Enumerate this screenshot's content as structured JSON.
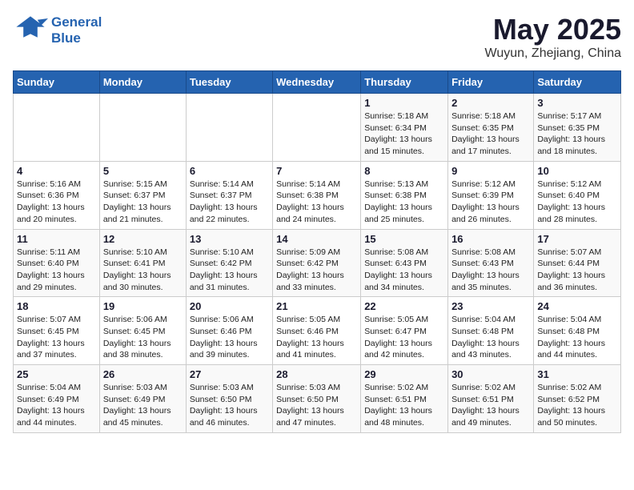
{
  "logo": {
    "line1": "General",
    "line2": "Blue"
  },
  "title": "May 2025",
  "location": "Wuyun, Zhejiang, China",
  "days_of_week": [
    "Sunday",
    "Monday",
    "Tuesday",
    "Wednesday",
    "Thursday",
    "Friday",
    "Saturday"
  ],
  "weeks": [
    [
      {
        "day": "",
        "info": ""
      },
      {
        "day": "",
        "info": ""
      },
      {
        "day": "",
        "info": ""
      },
      {
        "day": "",
        "info": ""
      },
      {
        "day": "1",
        "info": "Sunrise: 5:18 AM\nSunset: 6:34 PM\nDaylight: 13 hours\nand 15 minutes."
      },
      {
        "day": "2",
        "info": "Sunrise: 5:18 AM\nSunset: 6:35 PM\nDaylight: 13 hours\nand 17 minutes."
      },
      {
        "day": "3",
        "info": "Sunrise: 5:17 AM\nSunset: 6:35 PM\nDaylight: 13 hours\nand 18 minutes."
      }
    ],
    [
      {
        "day": "4",
        "info": "Sunrise: 5:16 AM\nSunset: 6:36 PM\nDaylight: 13 hours\nand 20 minutes."
      },
      {
        "day": "5",
        "info": "Sunrise: 5:15 AM\nSunset: 6:37 PM\nDaylight: 13 hours\nand 21 minutes."
      },
      {
        "day": "6",
        "info": "Sunrise: 5:14 AM\nSunset: 6:37 PM\nDaylight: 13 hours\nand 22 minutes."
      },
      {
        "day": "7",
        "info": "Sunrise: 5:14 AM\nSunset: 6:38 PM\nDaylight: 13 hours\nand 24 minutes."
      },
      {
        "day": "8",
        "info": "Sunrise: 5:13 AM\nSunset: 6:38 PM\nDaylight: 13 hours\nand 25 minutes."
      },
      {
        "day": "9",
        "info": "Sunrise: 5:12 AM\nSunset: 6:39 PM\nDaylight: 13 hours\nand 26 minutes."
      },
      {
        "day": "10",
        "info": "Sunrise: 5:12 AM\nSunset: 6:40 PM\nDaylight: 13 hours\nand 28 minutes."
      }
    ],
    [
      {
        "day": "11",
        "info": "Sunrise: 5:11 AM\nSunset: 6:40 PM\nDaylight: 13 hours\nand 29 minutes."
      },
      {
        "day": "12",
        "info": "Sunrise: 5:10 AM\nSunset: 6:41 PM\nDaylight: 13 hours\nand 30 minutes."
      },
      {
        "day": "13",
        "info": "Sunrise: 5:10 AM\nSunset: 6:42 PM\nDaylight: 13 hours\nand 31 minutes."
      },
      {
        "day": "14",
        "info": "Sunrise: 5:09 AM\nSunset: 6:42 PM\nDaylight: 13 hours\nand 33 minutes."
      },
      {
        "day": "15",
        "info": "Sunrise: 5:08 AM\nSunset: 6:43 PM\nDaylight: 13 hours\nand 34 minutes."
      },
      {
        "day": "16",
        "info": "Sunrise: 5:08 AM\nSunset: 6:43 PM\nDaylight: 13 hours\nand 35 minutes."
      },
      {
        "day": "17",
        "info": "Sunrise: 5:07 AM\nSunset: 6:44 PM\nDaylight: 13 hours\nand 36 minutes."
      }
    ],
    [
      {
        "day": "18",
        "info": "Sunrise: 5:07 AM\nSunset: 6:45 PM\nDaylight: 13 hours\nand 37 minutes."
      },
      {
        "day": "19",
        "info": "Sunrise: 5:06 AM\nSunset: 6:45 PM\nDaylight: 13 hours\nand 38 minutes."
      },
      {
        "day": "20",
        "info": "Sunrise: 5:06 AM\nSunset: 6:46 PM\nDaylight: 13 hours\nand 39 minutes."
      },
      {
        "day": "21",
        "info": "Sunrise: 5:05 AM\nSunset: 6:46 PM\nDaylight: 13 hours\nand 41 minutes."
      },
      {
        "day": "22",
        "info": "Sunrise: 5:05 AM\nSunset: 6:47 PM\nDaylight: 13 hours\nand 42 minutes."
      },
      {
        "day": "23",
        "info": "Sunrise: 5:04 AM\nSunset: 6:48 PM\nDaylight: 13 hours\nand 43 minutes."
      },
      {
        "day": "24",
        "info": "Sunrise: 5:04 AM\nSunset: 6:48 PM\nDaylight: 13 hours\nand 44 minutes."
      }
    ],
    [
      {
        "day": "25",
        "info": "Sunrise: 5:04 AM\nSunset: 6:49 PM\nDaylight: 13 hours\nand 44 minutes."
      },
      {
        "day": "26",
        "info": "Sunrise: 5:03 AM\nSunset: 6:49 PM\nDaylight: 13 hours\nand 45 minutes."
      },
      {
        "day": "27",
        "info": "Sunrise: 5:03 AM\nSunset: 6:50 PM\nDaylight: 13 hours\nand 46 minutes."
      },
      {
        "day": "28",
        "info": "Sunrise: 5:03 AM\nSunset: 6:50 PM\nDaylight: 13 hours\nand 47 minutes."
      },
      {
        "day": "29",
        "info": "Sunrise: 5:02 AM\nSunset: 6:51 PM\nDaylight: 13 hours\nand 48 minutes."
      },
      {
        "day": "30",
        "info": "Sunrise: 5:02 AM\nSunset: 6:51 PM\nDaylight: 13 hours\nand 49 minutes."
      },
      {
        "day": "31",
        "info": "Sunrise: 5:02 AM\nSunset: 6:52 PM\nDaylight: 13 hours\nand 50 minutes."
      }
    ]
  ]
}
